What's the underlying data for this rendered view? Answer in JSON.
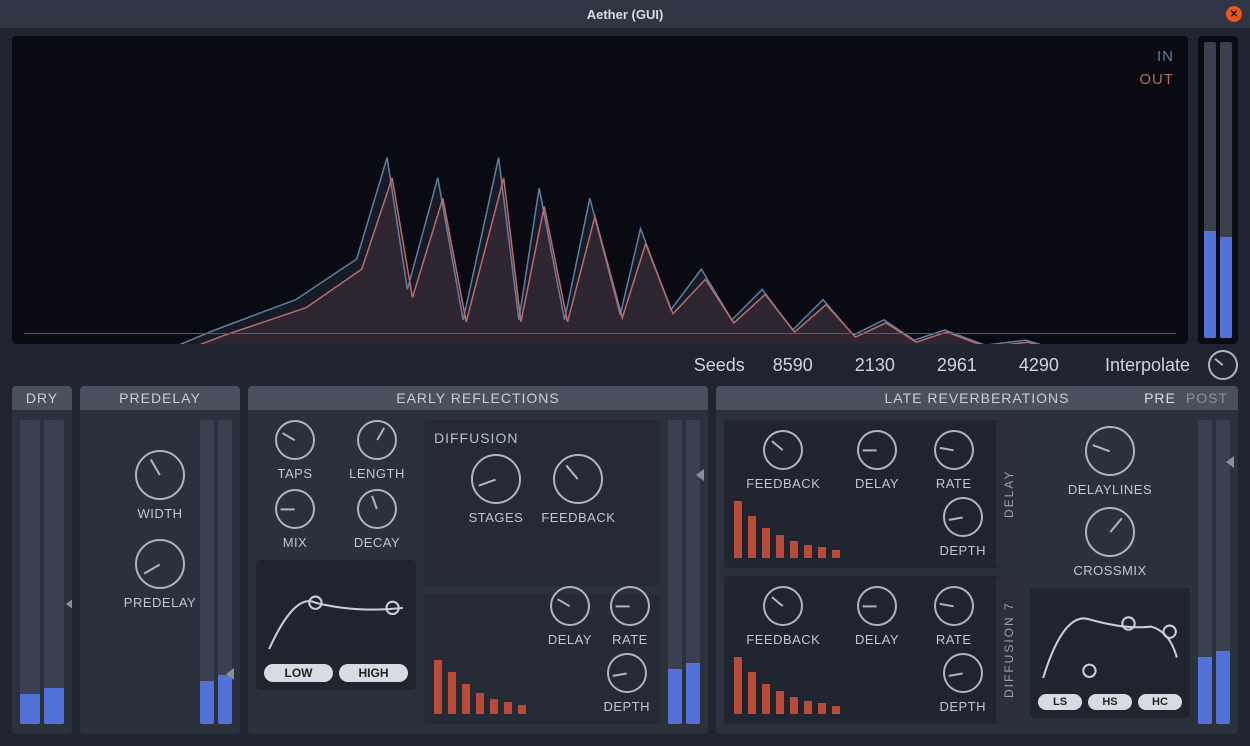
{
  "window": {
    "title": "Aether (GUI)"
  },
  "io": {
    "in": "IN",
    "out": "OUT"
  },
  "master_meter": {
    "left": 0.36,
    "right": 0.34
  },
  "seeds": {
    "label": "Seeds",
    "values": [
      "8590",
      "2130",
      "2961",
      "4290"
    ],
    "interpolate": "Interpolate"
  },
  "dry": {
    "title": "DRY",
    "meters": [
      0.1,
      0.12
    ]
  },
  "predelay": {
    "title": "PREDELAY",
    "width": "WIDTH",
    "predelay": "PREDELAY",
    "meters": [
      0.14,
      0.16
    ]
  },
  "early": {
    "title": "EARLY REFLECTIONS",
    "taps": "TAPS",
    "length": "LENGTH",
    "mix": "MIX",
    "decay": "DECAY",
    "diffusion": "DIFFUSION",
    "stages": "STAGES",
    "feedback": "FEEDBACK",
    "delay": "DELAY",
    "rate": "RATE",
    "depth": "DEPTH",
    "low": "LOW",
    "high": "HIGH",
    "meters": [
      0.18,
      0.2
    ],
    "bars": [
      0.9,
      0.7,
      0.5,
      0.35,
      0.25,
      0.2,
      0.15
    ]
  },
  "late": {
    "title": "LATE REVERBERATIONS",
    "pre": "PRE",
    "post": "POST",
    "feedback": "FEEDBACK",
    "delay": "DELAY",
    "rate": "RATE",
    "depth": "DEPTH",
    "delay_label": "DELAY",
    "diffusion_label": "DIFFUSION",
    "diffusion_n": "7",
    "delaylines": "DELAYLINES",
    "crossmix": "CROSSMIX",
    "ls": "LS",
    "hs": "HS",
    "hc": "HC",
    "meters": [
      0.22,
      0.24
    ],
    "bars1": [
      0.95,
      0.7,
      0.5,
      0.38,
      0.28,
      0.22,
      0.18,
      0.14
    ],
    "bars2": [
      0.95,
      0.7,
      0.5,
      0.38,
      0.28,
      0.22,
      0.18,
      0.14
    ]
  }
}
